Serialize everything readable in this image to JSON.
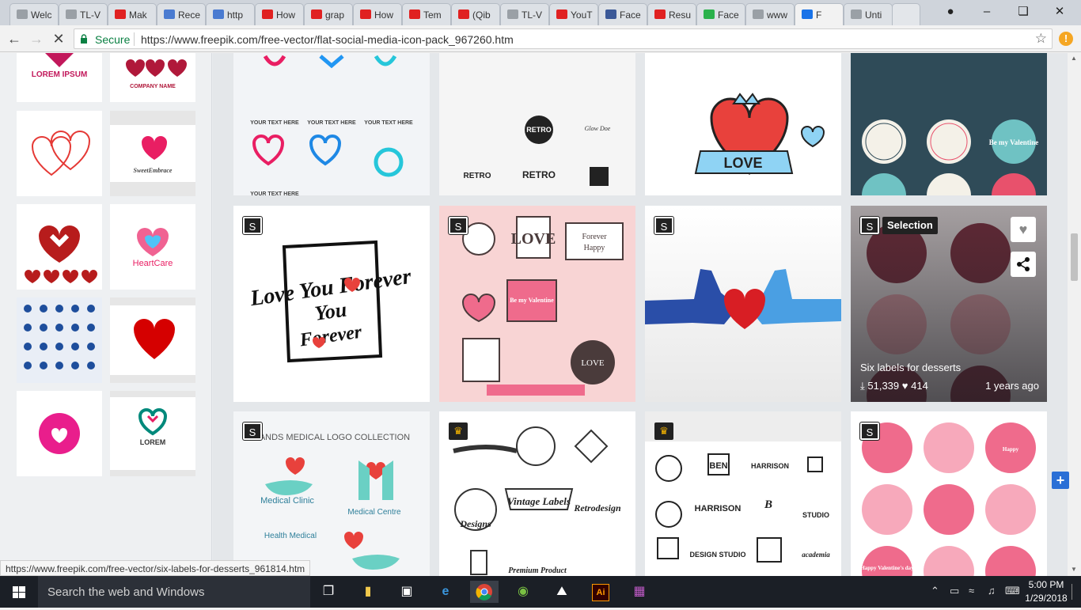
{
  "tabs": [
    {
      "label": "Welc",
      "icon": "page-icon",
      "color": "#9aa0a6"
    },
    {
      "label": "TL-V",
      "icon": "page-icon",
      "color": "#9aa0a6"
    },
    {
      "label": "Mak",
      "icon": "youtube-icon",
      "color": "#e02121"
    },
    {
      "label": "Rece",
      "icon": "meta-icon",
      "color": "#4a7bd1"
    },
    {
      "label": "http",
      "icon": "meta-icon",
      "color": "#4a7bd1"
    },
    {
      "label": "How",
      "icon": "youtube-icon",
      "color": "#e02121"
    },
    {
      "label": "grap",
      "icon": "youtube-icon",
      "color": "#e02121"
    },
    {
      "label": "How",
      "icon": "youtube-icon",
      "color": "#e02121"
    },
    {
      "label": "Tem",
      "icon": "youtube-icon",
      "color": "#e02121"
    },
    {
      "label": "(Qib",
      "icon": "youtube-icon",
      "color": "#e02121"
    },
    {
      "label": "TL-V",
      "icon": "page-icon",
      "color": "#9aa0a6"
    },
    {
      "label": "YouT",
      "icon": "youtube-icon",
      "color": "#e02121"
    },
    {
      "label": "Face",
      "icon": "facebook-icon",
      "color": "#3b5998"
    },
    {
      "label": "Resu",
      "icon": "youtube-icon",
      "color": "#e02121"
    },
    {
      "label": "Face",
      "icon": "feedly-icon",
      "color": "#2bb24c"
    },
    {
      "label": "www",
      "icon": "page-icon",
      "color": "#9aa0a6"
    },
    {
      "label": "F",
      "icon": "loading-icon",
      "color": "#1a73e8"
    },
    {
      "label": "Unti",
      "icon": "page-icon",
      "color": "#9aa0a6"
    }
  ],
  "address": {
    "secure_label": "Secure",
    "url": "https://www.freepik.com/free-vector/flat-social-media-icon-pack_967260.htm"
  },
  "sidebar_thumbs": [
    {
      "label": "LOREM IPSUM"
    },
    {
      "label": "COMPANY NAME"
    },
    {
      "label": ""
    },
    {
      "label": "SweetEmbrace"
    },
    {
      "label": ""
    },
    {
      "label": "HeartCare"
    },
    {
      "label": ""
    },
    {
      "label": ""
    },
    {
      "label": ""
    },
    {
      "label": "LOREM"
    }
  ],
  "cards": [
    {
      "caption": "YOUR TEXT HERE"
    },
    {
      "caption": "RETRO"
    },
    {
      "caption": "LOVE"
    },
    {
      "caption": "Be my Valentine"
    },
    {
      "caption": "Love You Forever"
    },
    {
      "caption": "Be my Valentine"
    },
    {
      "caption": ""
    },
    {
      "caption": ""
    },
    {
      "caption": "HANDS MEDICAL LOGO COLLECTION"
    },
    {
      "caption": "Vintage Labels"
    },
    {
      "caption": "HARRISON"
    },
    {
      "caption": "Happy Valentine's day"
    }
  ],
  "hover_card": {
    "selection_label": "Selection",
    "title": "Six labels for desserts",
    "downloads": "51,339",
    "likes": "414",
    "age": "1 years ago"
  },
  "status_bar_url": "https://www.freepik.com/free-vector/six-labels-for-desserts_961814.htm",
  "taskbar": {
    "search_placeholder": "Search the web and Windows",
    "time": "5:00 PM",
    "date": "1/29/2018"
  },
  "colors": {
    "secure_green": "#0b8043",
    "accent_blue": "#2a6fd6",
    "heart_red": "#e8413c",
    "pink": "#ef6b8c"
  }
}
